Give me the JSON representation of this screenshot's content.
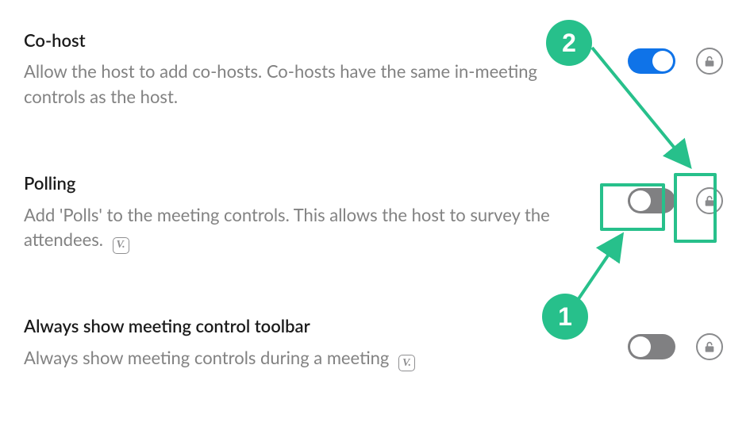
{
  "colors": {
    "accent_green": "#27c08b",
    "toggle_on": "#0f73e8",
    "toggle_off": "#808082",
    "text_muted": "#828282",
    "text_dark": "#1b1b1b",
    "icon_grey": "#8a8b8d"
  },
  "settings": [
    {
      "key": "co_host",
      "title": "Co-host",
      "description": "Allow the host to add co-hosts. Co-hosts have the same in-meeting controls as the host.",
      "toggle_on": true,
      "locked": false,
      "modified_badge": false
    },
    {
      "key": "polling",
      "title": "Polling",
      "description": "Add 'Polls' to the meeting controls. This allows the host to survey the attendees.",
      "toggle_on": false,
      "locked": false,
      "modified_badge": true
    },
    {
      "key": "always_show_toolbar",
      "title": "Always show meeting control toolbar",
      "description": "Always show meeting controls during a meeting",
      "toggle_on": false,
      "locked": false,
      "modified_badge": true
    }
  ],
  "badge_glyph": "V.",
  "annotations": {
    "step1": "1",
    "step2": "2"
  }
}
